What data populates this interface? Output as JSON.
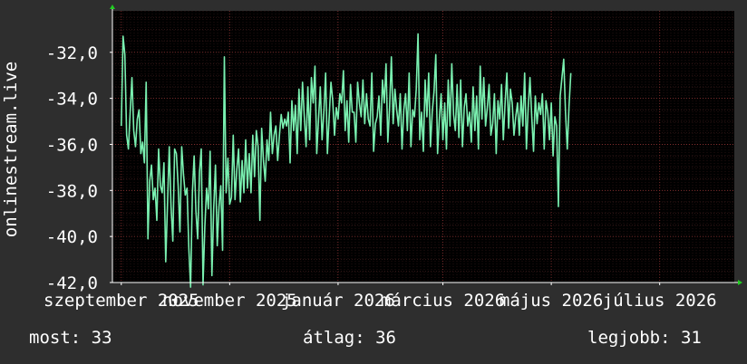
{
  "chart_data": {
    "type": "line",
    "ylabel": "onlinestream.live",
    "y_tick_labels": [
      "-32,0",
      "-34,0",
      "-36,0",
      "-38,0",
      "-40,0",
      "-42,0"
    ],
    "y_ticks": [
      -32,
      -34,
      -36,
      -38,
      -40,
      -42
    ],
    "ylim": [
      -42,
      -30.2
    ],
    "x_tick_labels": [
      "szeptember 2025",
      "november 2025",
      "január 2026",
      "március 2026",
      "május 2026",
      "július 2026"
    ],
    "x_ticks": [
      0,
      61,
      122,
      181,
      242,
      303
    ],
    "xlim": [
      -5,
      345
    ],
    "grid": true,
    "colors": {
      "background": "#2e2e2e",
      "plot_bg": "#000000",
      "line": "#7af0b0",
      "grid": "#5a2a2a",
      "axis": "#ffffff",
      "arrow": "#22cc22"
    },
    "series": [
      {
        "values": [
          -35.2,
          -31.3,
          -32.1,
          -35.6,
          -36.2,
          -34.6,
          -33.1,
          -35.4,
          -36.1,
          -34.9,
          -34.5,
          -36.4,
          -35.9,
          -36.8,
          -33.3,
          -40.1,
          -37.6,
          -36.9,
          -38.4,
          -37.9,
          -39.3,
          -36.2,
          -37.8,
          -38.1,
          -36.8,
          -41.1,
          -38.6,
          -36.1,
          -38.7,
          -40.2,
          -36.2,
          -36.4,
          -37.8,
          -39.8,
          -36.1,
          -37.3,
          -38.2,
          -37.9,
          -40.5,
          -42.2,
          -38.1,
          -36.5,
          -38.9,
          -40.1,
          -37.2,
          -36.2,
          -42.1,
          -39.6,
          -37.9,
          -38.8,
          -36.3,
          -41.7,
          -38.8,
          -36.9,
          -40.4,
          -38.7,
          -37.8,
          -40.6,
          -32.2,
          -38.1,
          -36.6,
          -38.6,
          -38.3,
          -35.6,
          -38.4,
          -37.1,
          -36.2,
          -38.5,
          -36.7,
          -38.1,
          -35.8,
          -37.9,
          -36.4,
          -38.1,
          -35.6,
          -37.4,
          -35.4,
          -36.1,
          -39.3,
          -35.3,
          -36.7,
          -37.6,
          -35.8,
          -36.7,
          -34.6,
          -36.4,
          -35.6,
          -35.2,
          -36.7,
          -35.6,
          -34.7,
          -35.3,
          -34.9,
          -35.2,
          -34.6,
          -36.8,
          -34.1,
          -35.4,
          -34.3,
          -36.4,
          -33.6,
          -35.4,
          -33.3,
          -34.8,
          -36.1,
          -33.5,
          -35.8,
          -33.1,
          -34.2,
          -32.6,
          -36.4,
          -34.9,
          -33.5,
          -35.8,
          -34.6,
          -32.9,
          -36.4,
          -34.8,
          -33.3,
          -34.1,
          -35.6,
          -34.4,
          -34.9,
          -33.8,
          -34.2,
          -32.8,
          -35.4,
          -34.1,
          -35.9,
          -33.4,
          -34.6,
          -34.6,
          -35.9,
          -33.3,
          -34.2,
          -34.8,
          -33.2,
          -35.1,
          -33.8,
          -34.9,
          -35.2,
          -32.9,
          -36.3,
          -35.1,
          -34.8,
          -33.9,
          -35.6,
          -33.2,
          -34.2,
          -32.5,
          -35.9,
          -34.4,
          -32.2,
          -35.1,
          -33.6,
          -34.5,
          -35.2,
          -33.8,
          -36.2,
          -34.5,
          -33.8,
          -35.4,
          -32.9,
          -36.1,
          -34.5,
          -34.8,
          -33.6,
          -31.2,
          -35.8,
          -34.6,
          -36.3,
          -33.2,
          -34.8,
          -32.9,
          -36.1,
          -34.6,
          -33.7,
          -32.1,
          -36.4,
          -34.9,
          -33.8,
          -35.8,
          -34.2,
          -36.2,
          -33.2,
          -35.2,
          -32.5,
          -34.7,
          -35.4,
          -33.4,
          -35.7,
          -33.2,
          -36.1,
          -34.4,
          -33.8,
          -35.2,
          -34.6,
          -35.9,
          -33.5,
          -35.4,
          -33.9,
          -36.2,
          -32.6,
          -34.9,
          -33.1,
          -35.2,
          -34.4,
          -33.4,
          -35.6,
          -35.1,
          -33.8,
          -36.4,
          -34.1,
          -34.9,
          -33.4,
          -35.8,
          -34.2,
          -32.9,
          -35.3,
          -33.6,
          -34.2,
          -35.6,
          -34.8,
          -34.2,
          -35.6,
          -33.9,
          -35.2,
          -32.9,
          -36.2,
          -34.4,
          -33.1,
          -34.8,
          -36.3,
          -33.9,
          -35.1,
          -34.2,
          -34.7,
          -33.8,
          -36.2,
          -34.1,
          -34.6,
          -35.8,
          -34.2,
          -36.5,
          -34.8,
          -35.2,
          -38.7,
          -33.9,
          -33.1,
          -32.3,
          -34.6,
          -36.2,
          -34.3,
          -32.9
        ],
        "color": "#7af0b0"
      }
    ]
  },
  "stats": {
    "now": "most: 33",
    "avg": "átlag: 36",
    "best": "legjobb: 31"
  }
}
